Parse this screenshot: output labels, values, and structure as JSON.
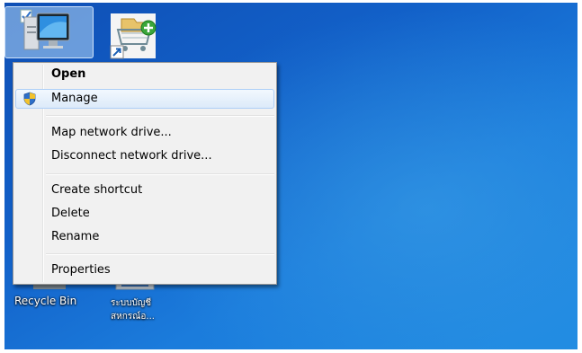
{
  "desktop": {
    "icons": [
      {
        "name": "Computer",
        "label": ""
      },
      {
        "name": "Shortcut app",
        "label": ""
      },
      {
        "name": "Recycle Bin",
        "label": "Recycle Bin"
      },
      {
        "name": "Thai shortcut",
        "label_line1": "ระบบบัญชี",
        "label_line2": "สหกรณ์อ..."
      }
    ]
  },
  "context_menu": {
    "items": [
      {
        "label": "Open",
        "bold": true
      },
      {
        "label": "Manage",
        "icon": "uac-shield-icon",
        "highlighted": true
      },
      {
        "label": "Map network drive..."
      },
      {
        "label": "Disconnect network drive..."
      },
      {
        "label": "Create shortcut"
      },
      {
        "label": "Delete"
      },
      {
        "label": "Rename"
      },
      {
        "label": "Properties"
      }
    ]
  },
  "colors": {
    "desktop_top": "#0f4fb5",
    "desktop_bottom": "#1f8be2",
    "menu_bg": "#f1f1f1",
    "highlight_border": "#aecff7"
  }
}
